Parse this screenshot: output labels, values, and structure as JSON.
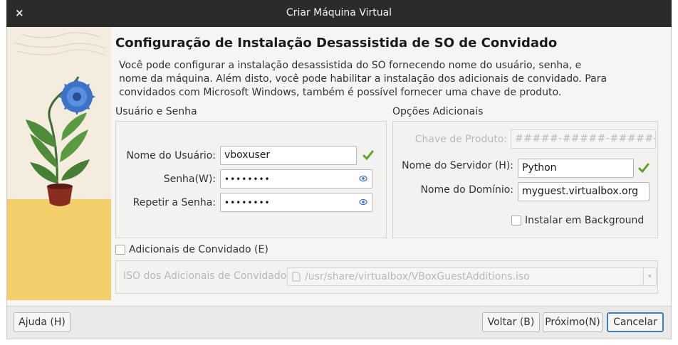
{
  "window": {
    "title": "Criar Máquina Virtual",
    "close_label": "×"
  },
  "page": {
    "heading": "Configuração de Instalação Desassistida de SO de Convidado",
    "description": "Você pode configurar a instalação desassistida do SO fornecendo nome do usuário, senha, e nome da máquina. Além disto, você pode habilitar a instalação dos adicionais de convidado. Para convidados com Microsoft Windows, também é possível fornecer uma chave de produto."
  },
  "user_section": {
    "title": "Usuário e Senha",
    "username_label": "Nome do Usuário:",
    "username_value": "vboxuser",
    "password_label": "Senha(W):",
    "password_value": "••••••••",
    "repeat_label": "Repetir a Senha:",
    "repeat_value": "••••••••"
  },
  "additional_section": {
    "title": "Opções Adicionais",
    "product_key_label": "Chave de Produto:",
    "product_key_placeholder": "#####-#####-#####-#####",
    "hostname_label": "Nome do Servidor (H):",
    "hostname_value": "Python",
    "domain_label": "Nome do Domínio:",
    "domain_value": "myguest.virtualbox.org",
    "background_label": "Instalar em Background",
    "background_checked": false
  },
  "guest_additions": {
    "checkbox_label": "Adicionais de Convidado (E)",
    "checked": false,
    "iso_label": "ISO dos Adicionais de Convidado:",
    "iso_path": "/usr/share/virtualbox/VBoxGuestAdditions.iso"
  },
  "buttons": {
    "help": "Ajuda (H)",
    "back": "Voltar (B)",
    "next": "Próximo(N)",
    "cancel": "Cancelar"
  },
  "colors": {
    "valid_check": "#5fa32a",
    "title_bar": "#2b2b2b",
    "accent": "#3d7fc6"
  }
}
